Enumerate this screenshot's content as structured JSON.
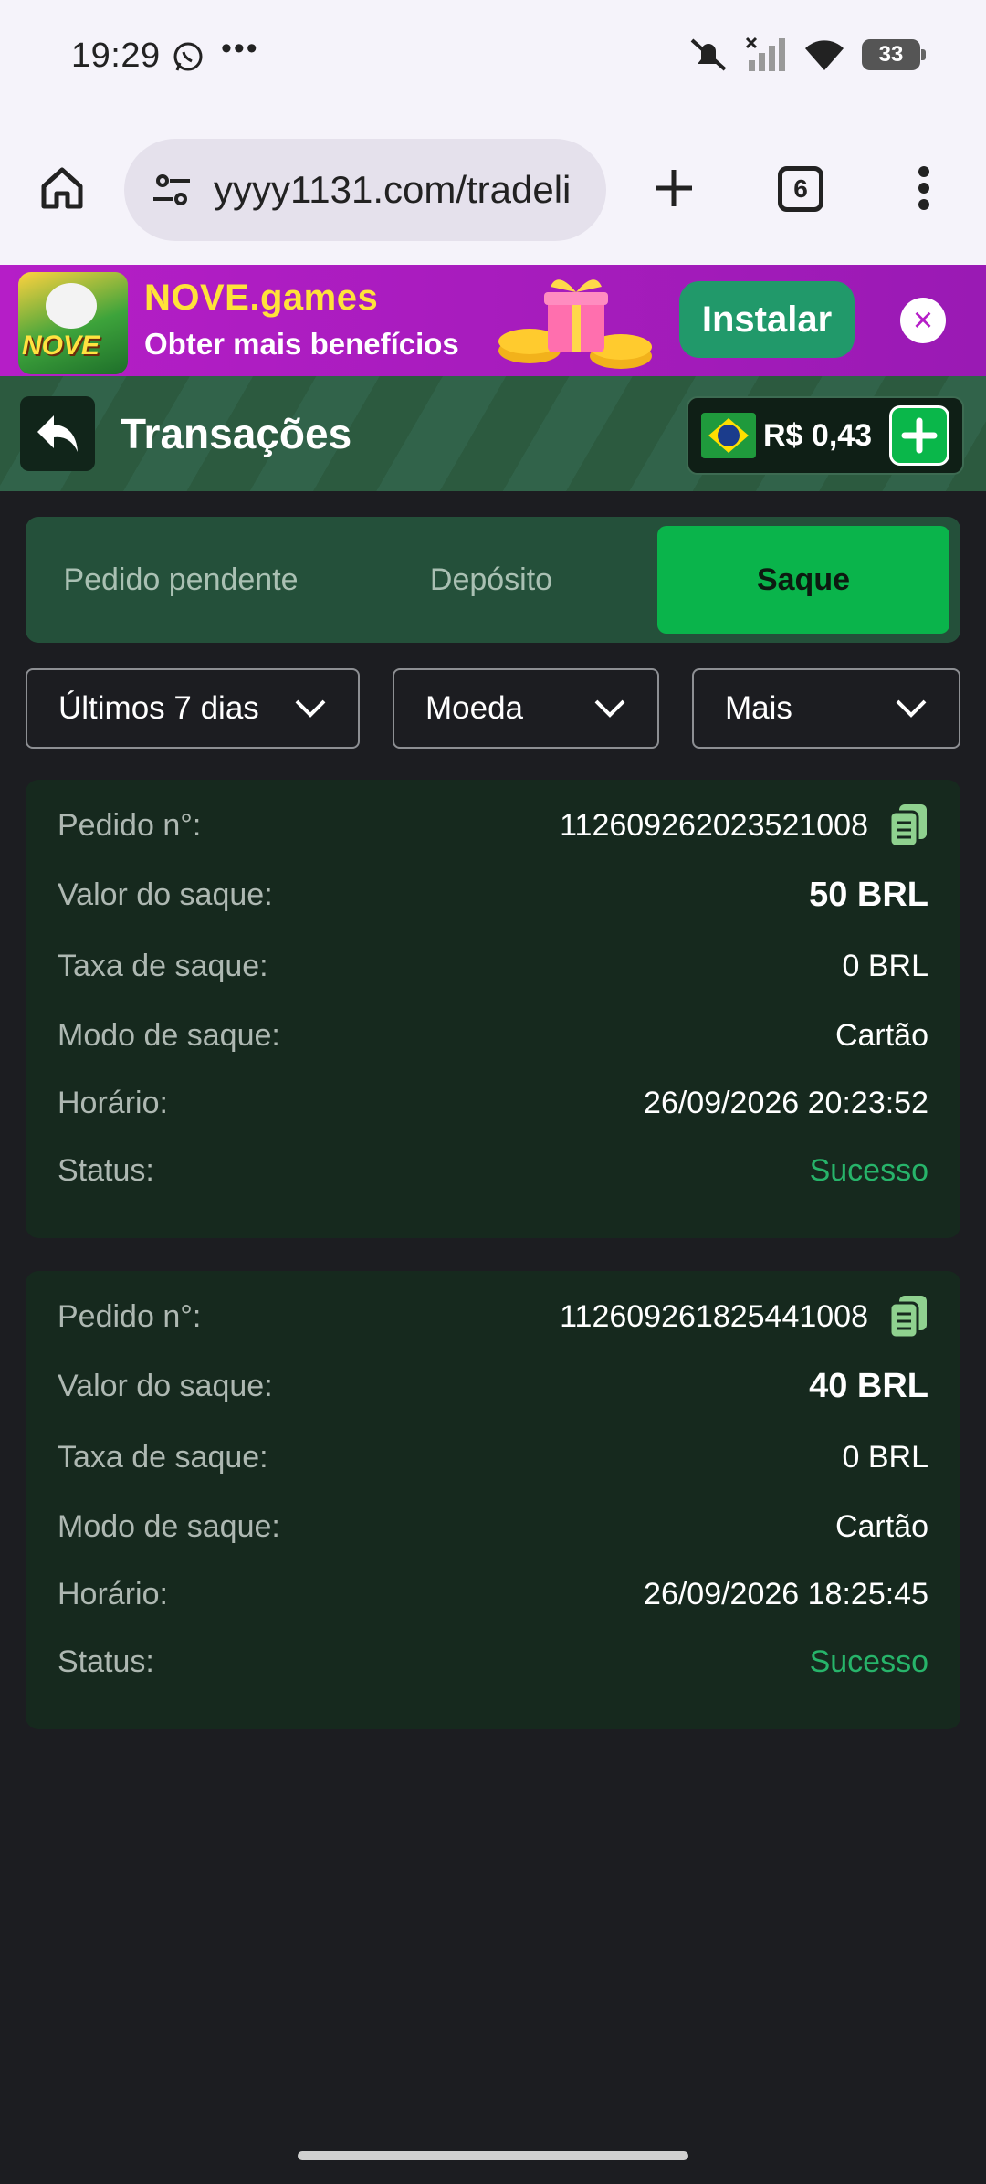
{
  "status_bar": {
    "time": "19:29",
    "battery": "33"
  },
  "browser": {
    "url": "yyyy1131.com/tradeli",
    "tab_count": "6"
  },
  "banner": {
    "title": "NOVE.games",
    "subtitle": "Obter mais benefícios",
    "install_label": "Instalar",
    "close_glyph": "×"
  },
  "header": {
    "title": "Transações",
    "balance": "R$ 0,43"
  },
  "tabs": [
    {
      "label": "Pedido pendente",
      "active": false
    },
    {
      "label": "Depósito",
      "active": false
    },
    {
      "label": "Saque",
      "active": true
    }
  ],
  "filters": {
    "period": "Últimos 7 dias",
    "currency": "Moeda",
    "more": "Mais"
  },
  "labels": {
    "order": "Pedido n°:",
    "amount": "Valor do saque:",
    "fee": "Taxa de saque:",
    "mode": "Modo de saque:",
    "time": "Horário:",
    "status": "Status:"
  },
  "transactions": [
    {
      "order_no": "112609262023521008",
      "amount": "50 BRL",
      "fee": "0 BRL",
      "mode": "Cartão",
      "time": "26/09/2026 20:23:52",
      "status": "Sucesso"
    },
    {
      "order_no": "112609261825441008",
      "amount": "40 BRL",
      "fee": "0 BRL",
      "mode": "Cartão",
      "time": "26/09/2026 18:25:45",
      "status": "Sucesso"
    }
  ],
  "colors": {
    "accent_green": "#0ab44b",
    "success": "#27b46a",
    "card_bg": "#16291e",
    "banner_purple": "#b51ec7"
  },
  "icons": [
    "whatsapp-icon",
    "mute-icon",
    "signal-icon",
    "wifi-icon",
    "home-icon",
    "site-settings-icon",
    "plus-icon",
    "more-vert-icon",
    "back-arrow-icon",
    "brazil-flag-icon",
    "add-funds-icon",
    "chevron-down-icon",
    "copy-icon",
    "close-icon"
  ]
}
